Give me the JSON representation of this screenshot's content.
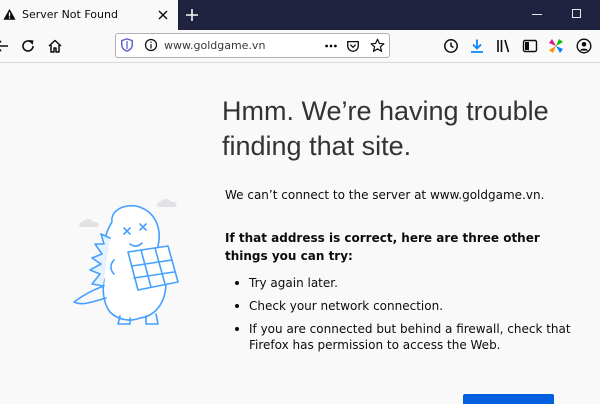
{
  "tab": {
    "title": "Server Not Found",
    "close_icon": "close-icon",
    "warning_icon": "warning-icon",
    "newtab_icon": "plus-icon"
  },
  "window_controls": [
    "minimize-icon",
    "maximize-icon"
  ],
  "nav": {
    "back_icon": "back-arrow-icon",
    "reload_icon": "reload-icon",
    "home_icon": "home-icon",
    "url": "www.goldgame.vn",
    "url_icons": [
      "tracking-protection-shield-icon",
      "info-icon"
    ],
    "page_action_icons": [
      "more-dots-icon",
      "pocket-icon",
      "bookmark-star-icon"
    ],
    "toolbar_icons": [
      "history-clock-icon",
      "download-icon",
      "library-icon",
      "sidebar-icon",
      "extension-icon",
      "account-icon"
    ]
  },
  "error": {
    "title": "Hmm. We’re having trouble finding that site.",
    "description": "We can’t connect to the server at www.goldgame.vn.",
    "suggestions_heading": "If that address is correct, here are three other things you can try:",
    "suggestions": [
      "Try again later.",
      "Check your network connection.",
      "If you are connected but behind a firewall, check that Firefox has permission to access the Web."
    ]
  },
  "colors": {
    "tab_strip": "#202340",
    "page_background": "#f9f9fa",
    "download_icon": "#0a84ff",
    "primary_button": "#0060df",
    "illustration_stroke": "#45a1ff"
  }
}
